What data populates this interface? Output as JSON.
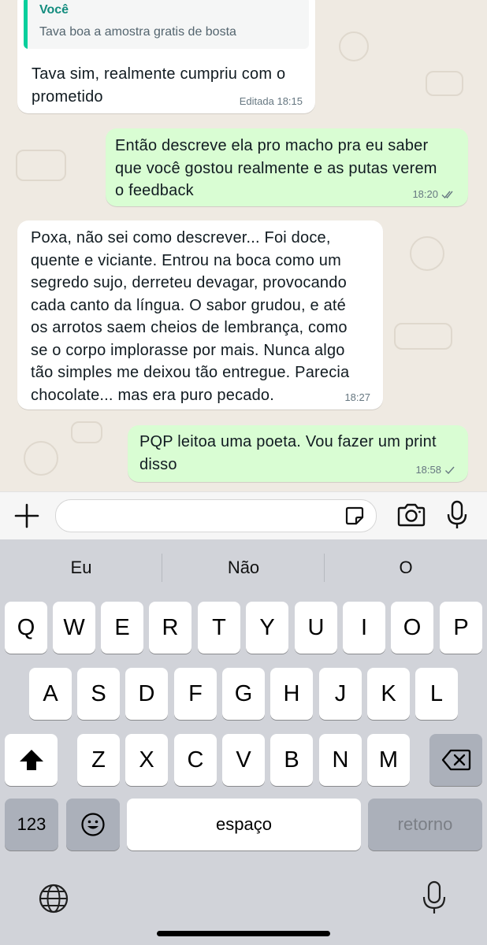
{
  "messages": [
    {
      "side": "in",
      "quote": {
        "author": "Você",
        "text": "Tava boa a amostra gratis de bosta"
      },
      "lines": [
        "Tava sim, realmente cumpriu com o",
        "prometido"
      ],
      "meta": "Editada 18:15"
    },
    {
      "side": "out",
      "lines": [
        "Então descreve ela pro macho pra eu saber",
        "que você gostou realmente e as putas verem",
        "o feedback"
      ],
      "time": "18:20",
      "status": "read"
    },
    {
      "side": "in",
      "lines": [
        "Poxa, não sei como descrever... Foi doce,",
        "quente e viciante. Entrou na boca como um",
        "segredo sujo, derreteu devagar, provocando",
        "cada canto da língua. O sabor grudou, e até",
        "os arrotos saem cheios de lembrança, como",
        "se o corpo implorasse por mais. Nunca algo",
        "tão simples me deixou tão entregue. Parecia",
        "chocolate... mas era puro pecado."
      ],
      "time": "18:27"
    },
    {
      "side": "out",
      "lines": [
        "PQP leitoa uma poeta. Vou fazer um print",
        "disso"
      ],
      "time": "18:58",
      "status": "sent"
    }
  ],
  "compose": {
    "placeholder": ""
  },
  "keyboard": {
    "suggestions": [
      "Eu",
      "Não",
      "O"
    ],
    "row1": [
      "Q",
      "W",
      "E",
      "R",
      "T",
      "Y",
      "U",
      "I",
      "O",
      "P"
    ],
    "row2": [
      "A",
      "S",
      "D",
      "F",
      "G",
      "H",
      "J",
      "K",
      "L"
    ],
    "row3": [
      "Z",
      "X",
      "C",
      "V",
      "B",
      "N",
      "M"
    ],
    "numbers_key": "123",
    "space_key": "espaço",
    "return_key": "retorno"
  },
  "colors": {
    "chat_bg": "#efeae2",
    "outgoing": "#d9fdd3",
    "incoming": "#ffffff",
    "quote_accent": "#06cf9c",
    "read_ticks": "#667781"
  },
  "icons": {
    "add": "plus-icon",
    "sticker": "sticker-icon",
    "camera": "camera-icon",
    "mic": "microphone-icon",
    "globe": "globe-icon",
    "dictation": "dictation-icon",
    "shift": "shift-icon",
    "backspace": "backspace-icon",
    "emoji": "emoji-icon"
  }
}
